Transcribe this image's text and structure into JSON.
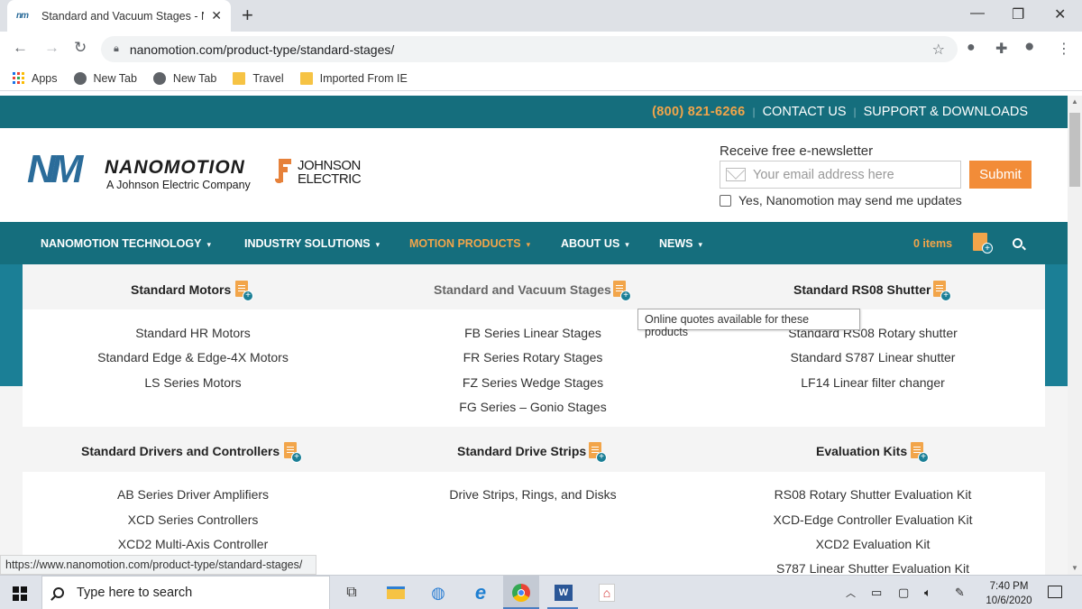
{
  "browser": {
    "tab_title": "Standard and Vacuum Stages - N",
    "tab_favicon": "nm",
    "url": "nanomotion.com/product-type/standard-stages/",
    "bookmarks": [
      {
        "label": "Apps",
        "icon": "apps-grid-icon"
      },
      {
        "label": "New Tab",
        "icon": "globe-icon"
      },
      {
        "label": "New Tab",
        "icon": "globe-icon"
      },
      {
        "label": "Travel",
        "icon": "folder-icon"
      },
      {
        "label": "Imported From IE",
        "icon": "folder-icon"
      }
    ],
    "status_url": "https://www.nanomotion.com/product-type/standard-stages/"
  },
  "site": {
    "phone": "(800) 821-6266",
    "top_links": [
      "CONTACT US",
      "SUPPORT & DOWNLOADS"
    ],
    "logo_mark": "NM",
    "logo_name": "NANOMOTION",
    "logo_sub": "A Johnson Electric Company",
    "partner_logo": [
      "JOHNSON",
      "ELECTRIC"
    ],
    "newsletter": {
      "title": "Receive free e-newsletter",
      "placeholder": "Your email address here",
      "submit": "Submit",
      "consent": "Yes, Nanomotion may send me updates"
    },
    "nav": [
      {
        "label": "NANOMOTION TECHNOLOGY",
        "active": false
      },
      {
        "label": "INDUSTRY SOLUTIONS",
        "active": false
      },
      {
        "label": "MOTION PRODUCTS",
        "active": true
      },
      {
        "label": "ABOUT US",
        "active": false
      },
      {
        "label": "NEWS",
        "active": false
      }
    ],
    "cart_count": "0 items",
    "accent_orange": "#f2a54a",
    "brand_teal": "#156e7d"
  },
  "mega_menu": {
    "row1": [
      {
        "title": "Standard Motors",
        "items": [
          "Standard HR Motors",
          "Standard Edge & Edge-4X Motors",
          "LS Series Motors"
        ]
      },
      {
        "title": "Standard and Vacuum Stages",
        "items": [
          "FB Series Linear Stages",
          "FR Series Rotary Stages",
          "FZ Series Wedge Stages",
          "FG Series – Gonio Stages"
        ]
      },
      {
        "title": "Standard RS08 Shutter",
        "items": [
          "Standard RS08 Rotary shutter",
          "Standard S787 Linear shutter",
          "LF14 Linear filter changer"
        ]
      }
    ],
    "row2": [
      {
        "title": "Standard Drivers and Controllers",
        "items": [
          "AB Series Driver Amplifiers",
          "XCD Series Controllers",
          "XCD2 Multi-Axis Controller"
        ]
      },
      {
        "title": "Standard Drive Strips",
        "items": [
          "Drive Strips, Rings, and Disks"
        ]
      },
      {
        "title": "Evaluation Kits",
        "items": [
          "RS08 Rotary Shutter Evaluation Kit",
          "XCD-Edge Controller Evaluation Kit",
          "XCD2 Evaluation Kit",
          "S787 Linear Shutter Evaluation Kit"
        ]
      }
    ],
    "tooltip": "Online quotes available for these products"
  },
  "taskbar": {
    "search_placeholder": "Type here to search",
    "time": "7:40 PM",
    "date": "10/6/2020",
    "word_letter": "W"
  }
}
